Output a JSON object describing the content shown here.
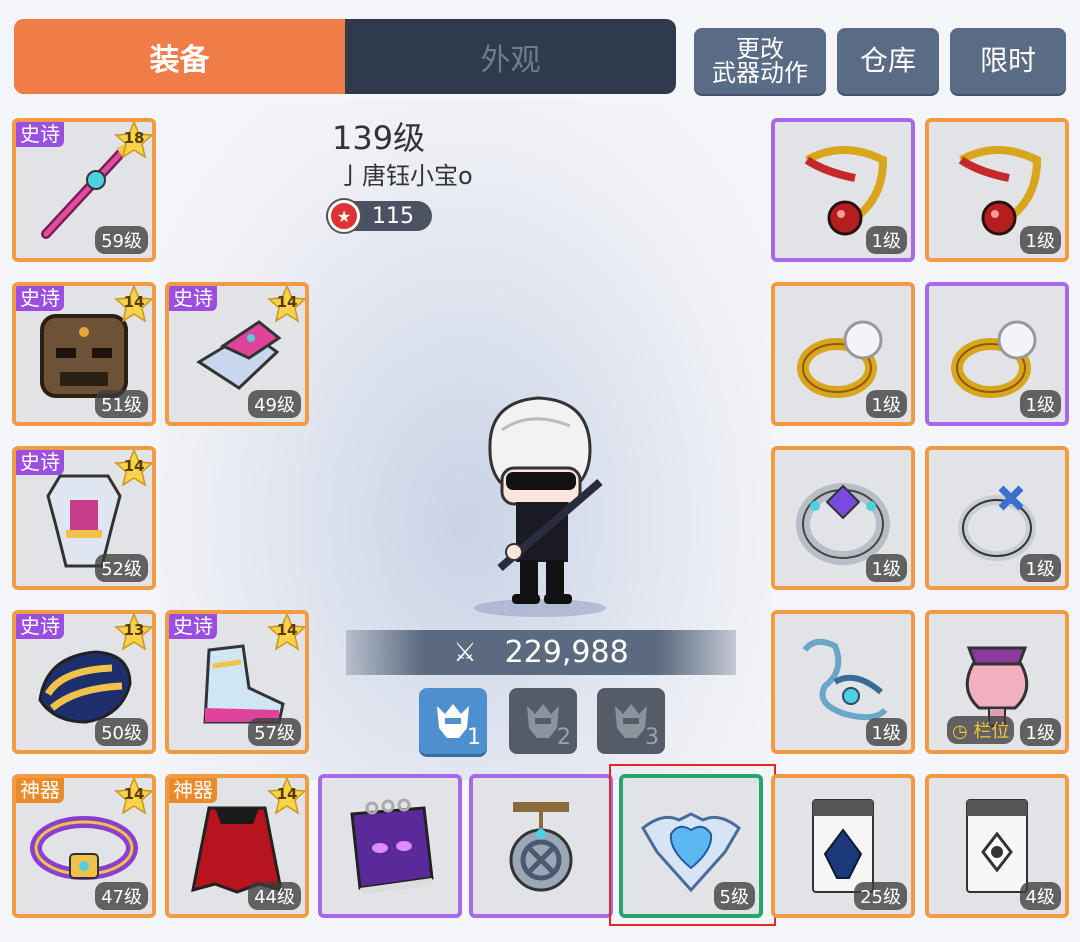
{
  "tabs": {
    "equipment": "装备",
    "appearance": "外观"
  },
  "top_buttons": {
    "change_weapon_line1": "更改",
    "change_weapon_line2": "武器动作",
    "warehouse": "仓库",
    "limited": "限时"
  },
  "character": {
    "level": "139级",
    "name": "亅唐钰小宝o",
    "honor": "115",
    "power": "229,988"
  },
  "presets": [
    "1",
    "2",
    "3"
  ],
  "slots": {
    "weapon": {
      "badge": "史诗",
      "stars": "18",
      "level": "59级"
    },
    "helmet": {
      "badge": "史诗",
      "stars": "14",
      "level": "51级"
    },
    "gloves": {
      "badge": "史诗",
      "stars": "14",
      "level": "49级"
    },
    "top": {
      "badge": "史诗",
      "stars": "14",
      "level": "52级"
    },
    "shoulder": {
      "badge": "史诗",
      "stars": "13",
      "level": "50级"
    },
    "shoes": {
      "badge": "史诗",
      "stars": "14",
      "level": "57级"
    },
    "belt": {
      "badge": "神器",
      "stars": "14",
      "level": "47级"
    },
    "cape": {
      "badge": "神器",
      "stars": "14",
      "level": "44级"
    },
    "necklace1": {
      "level": "1级"
    },
    "necklace2": {
      "level": "1级"
    },
    "ring1": {
      "level": "1级"
    },
    "ring2": {
      "level": "1级"
    },
    "ring3": {
      "level": "1级"
    },
    "ring4": {
      "level": "1级"
    },
    "pendant": {
      "level": "1级"
    },
    "pocket": {
      "level": "1级",
      "slot_label": "栏位"
    },
    "emblem": {
      "level": "5级"
    },
    "badge1": {
      "level": "25级"
    },
    "badge2": {
      "level": "4级"
    }
  },
  "colors": {
    "accent_orange": "#f07d47",
    "rare_purple": "#a66ae8",
    "legend_orange": "#f39a45",
    "selected_green": "#27a56b",
    "highlight_red": "#e02a2a"
  }
}
